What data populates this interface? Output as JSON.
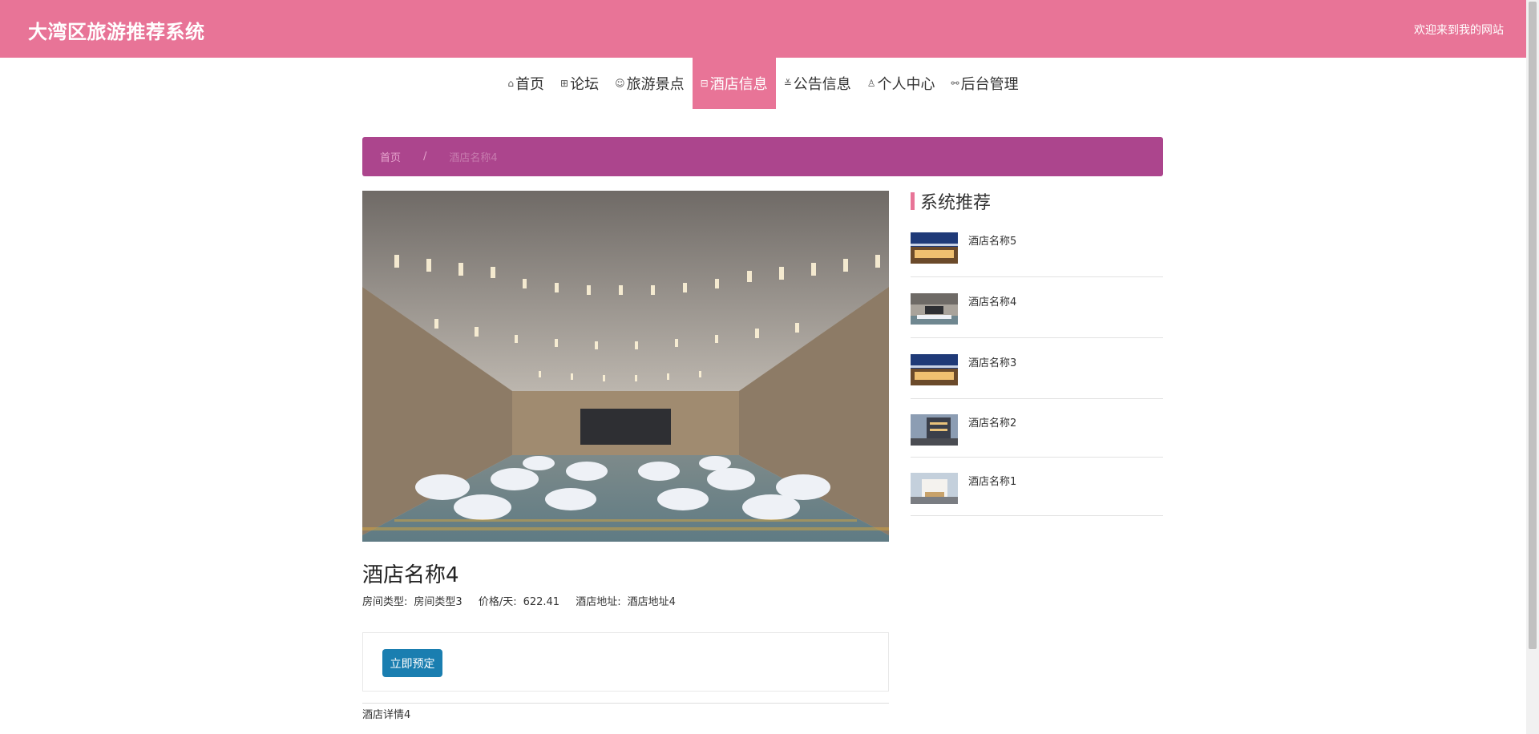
{
  "header": {
    "title": "大湾区旅游推荐系统",
    "welcome": "欢迎来到我的网站"
  },
  "nav": [
    {
      "icon": "home-icon",
      "glyph": "⌂",
      "label": "首页",
      "active": false
    },
    {
      "icon": "forum-icon",
      "glyph": "⊞",
      "label": "论坛",
      "active": false
    },
    {
      "icon": "scenic-icon",
      "glyph": "☺",
      "label": "旅游景点",
      "active": false
    },
    {
      "icon": "hotel-icon",
      "glyph": "⊟",
      "label": "酒店信息",
      "active": true
    },
    {
      "icon": "notice-icon",
      "glyph": "≚",
      "label": "公告信息",
      "active": false
    },
    {
      "icon": "user-icon",
      "glyph": "♙",
      "label": "个人中心",
      "active": false
    },
    {
      "icon": "link-icon",
      "glyph": "⚯",
      "label": "后台管理",
      "active": false
    }
  ],
  "breadcrumb": {
    "home": "首页",
    "separator": "/",
    "current": "酒店名称4"
  },
  "hotel": {
    "name": "酒店名称4",
    "room_type_label": "房间类型:",
    "room_type": "房间类型3",
    "price_label": "价格/天:",
    "price": "622.41",
    "address_label": "酒店地址:",
    "address": "酒店地址4",
    "book_button": "立即预定",
    "detail": "酒店详情4"
  },
  "sidebar": {
    "title": "系统推荐",
    "items": [
      {
        "name": "酒店名称5",
        "image": "hotel-exterior-night"
      },
      {
        "name": "酒店名称4",
        "image": "banquet-hall"
      },
      {
        "name": "酒店名称3",
        "image": "hotel-exterior-night"
      },
      {
        "name": "酒店名称2",
        "image": "hotel-building-dusk"
      },
      {
        "name": "酒店名称1",
        "image": "hotel-building-white"
      }
    ]
  },
  "colors": {
    "header": "#e87497",
    "breadcrumb": "#ac458d",
    "button": "#1a7eb0"
  }
}
